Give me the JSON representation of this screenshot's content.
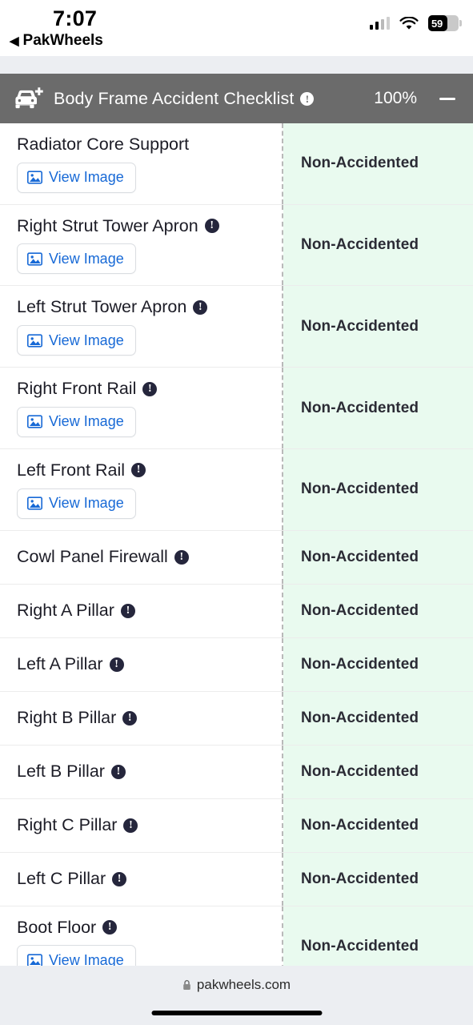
{
  "status_bar": {
    "time": "7:07",
    "back_label": "PakWheels",
    "back_arrow": "◀",
    "battery_percent": "59",
    "signal_icon": "cellular-bars-icon",
    "wifi_icon": "wifi-icon"
  },
  "section_header": {
    "icon": "car-plus-icon",
    "title": "Body Frame Accident Checklist",
    "info_icon": "info-circle-icon",
    "info_glyph": "!",
    "percent": "100%",
    "collapse_icon": "minus-icon",
    "bg_color": "#6b6b6b"
  },
  "colors": {
    "status_bg": "#e9faef",
    "link": "#1769d6",
    "info_dark": "#25263c",
    "divider": "#ececec"
  },
  "common": {
    "view_image_label": "View Image",
    "view_image_icon": "image-icon",
    "info_glyph": "!",
    "status_value": "Non-Accidented"
  },
  "rows": [
    {
      "name": "Radiator Core Support",
      "has_info": false,
      "has_image": true,
      "status": "Non-Accidented"
    },
    {
      "name": "Right Strut Tower Apron",
      "has_info": true,
      "has_image": true,
      "status": "Non-Accidented"
    },
    {
      "name": "Left Strut Tower Apron",
      "has_info": true,
      "has_image": true,
      "status": "Non-Accidented"
    },
    {
      "name": "Right Front Rail",
      "has_info": true,
      "has_image": true,
      "status": "Non-Accidented"
    },
    {
      "name": "Left Front Rail",
      "has_info": true,
      "has_image": true,
      "status": "Non-Accidented"
    },
    {
      "name": "Cowl Panel Firewall",
      "has_info": true,
      "has_image": false,
      "status": "Non-Accidented"
    },
    {
      "name": "Right A Pillar",
      "has_info": true,
      "has_image": false,
      "status": "Non-Accidented"
    },
    {
      "name": "Left A Pillar",
      "has_info": true,
      "has_image": false,
      "status": "Non-Accidented"
    },
    {
      "name": "Right B Pillar",
      "has_info": true,
      "has_image": false,
      "status": "Non-Accidented"
    },
    {
      "name": "Left B Pillar",
      "has_info": true,
      "has_image": false,
      "status": "Non-Accidented"
    },
    {
      "name": "Right C Pillar",
      "has_info": true,
      "has_image": false,
      "status": "Non-Accidented"
    },
    {
      "name": "Left C Pillar",
      "has_info": true,
      "has_image": false,
      "status": "Non-Accidented"
    },
    {
      "name": "Boot Floor",
      "has_info": true,
      "has_image": true,
      "status": "Non-Accidented"
    }
  ],
  "browser_bar": {
    "lock_icon": "lock-icon",
    "url": "pakwheels.com",
    "home_indicator": "home-indicator"
  }
}
